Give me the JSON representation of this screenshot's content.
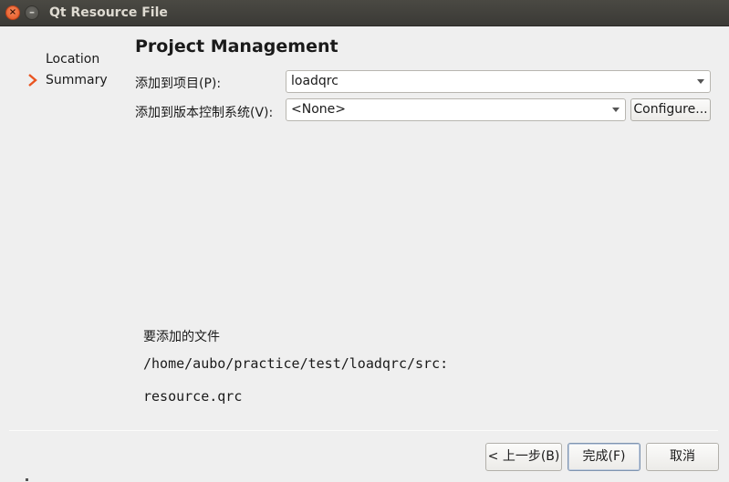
{
  "window": {
    "title": "Qt Resource File",
    "close_glyph": "×",
    "minimize_glyph": "–"
  },
  "steps": {
    "items": [
      "Location",
      "Summary"
    ],
    "current": "Summary",
    "accent": "#e95420"
  },
  "page": {
    "heading": "Project Management"
  },
  "form": {
    "project_label": "添加到项目(P):",
    "project_value": "loadqrc",
    "vcs_label": "添加到版本控制系统(V):",
    "vcs_value": "<None>",
    "configure_label": "Configure..."
  },
  "files": {
    "caption": "要添加的文件",
    "directory": "/home/aubo/practice/test/loadqrc/src:",
    "file": "resource.qrc"
  },
  "buttons": {
    "back": "< 上一步(B)",
    "finish": "完成(F)",
    "cancel": "取消"
  }
}
